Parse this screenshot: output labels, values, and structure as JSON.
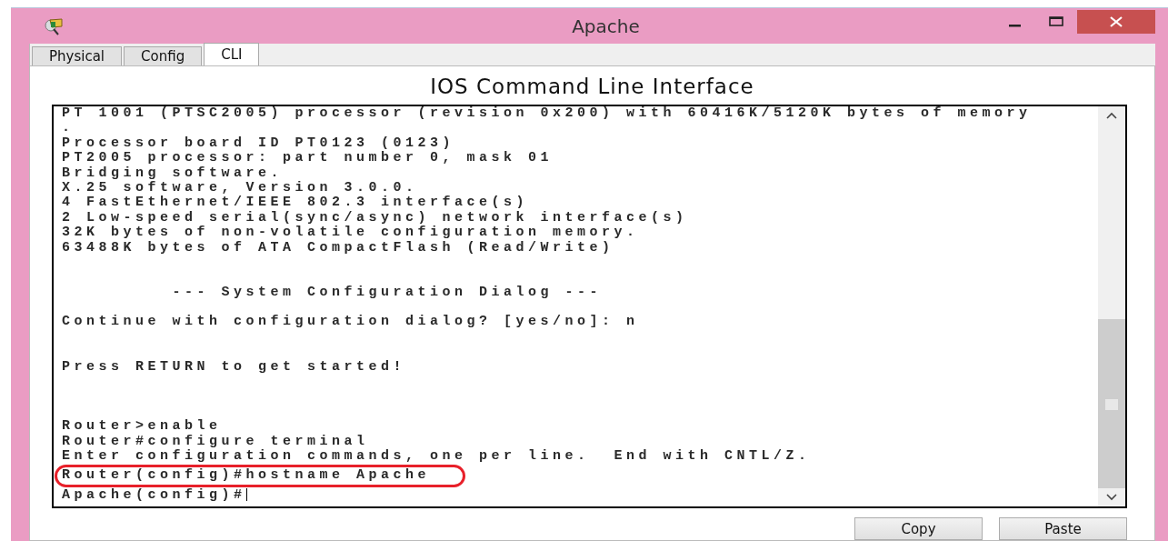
{
  "window": {
    "title": "Apache"
  },
  "tabs": [
    {
      "label": "Physical",
      "selected": false
    },
    {
      "label": "Config",
      "selected": false
    },
    {
      "label": "CLI",
      "selected": true
    }
  ],
  "heading": "IOS Command Line Interface",
  "terminal": {
    "lines": [
      {
        "kind": "text",
        "text": "PT 1001 (PTSC2005) processor (revision 0x200) with 60416K/5120K bytes of memory"
      },
      {
        "kind": "text",
        "text": "."
      },
      {
        "kind": "text",
        "text": "Processor board ID PT0123 (0123)"
      },
      {
        "kind": "text",
        "text": "PT2005 processor: part number 0, mask 01"
      },
      {
        "kind": "text",
        "text": "Bridging software."
      },
      {
        "kind": "text",
        "text": "X.25 software, Version 3.0.0."
      },
      {
        "kind": "text",
        "text": "4 FastEthernet/IEEE 802.3 interface(s)"
      },
      {
        "kind": "text",
        "text": "2 Low-speed serial(sync/async) network interface(s)"
      },
      {
        "kind": "text",
        "text": "32K bytes of non-volatile configuration memory."
      },
      {
        "kind": "text",
        "text": "63488K bytes of ATA CompactFlash (Read/Write)"
      },
      {
        "kind": "blank"
      },
      {
        "kind": "blank"
      },
      {
        "kind": "text",
        "text": "         --- System Configuration Dialog ---"
      },
      {
        "kind": "blank"
      },
      {
        "kind": "text",
        "text": "Continue with configuration dialog? [yes/no]: n"
      },
      {
        "kind": "blank"
      },
      {
        "kind": "blank"
      },
      {
        "kind": "text",
        "text": "Press RETURN to get started!"
      },
      {
        "kind": "blank"
      },
      {
        "kind": "blank"
      },
      {
        "kind": "blank"
      },
      {
        "kind": "text",
        "text": "Router>enable"
      },
      {
        "kind": "text",
        "text": "Router#configure terminal"
      },
      {
        "kind": "text",
        "text": "Enter configuration commands, one per line.  End with CNTL/Z."
      },
      {
        "kind": "highlighted",
        "text": "Router(config)#hostname Apache"
      },
      {
        "kind": "prompt",
        "text": "Apache(config)#"
      }
    ]
  },
  "buttons": [
    "Copy",
    "Paste"
  ]
}
